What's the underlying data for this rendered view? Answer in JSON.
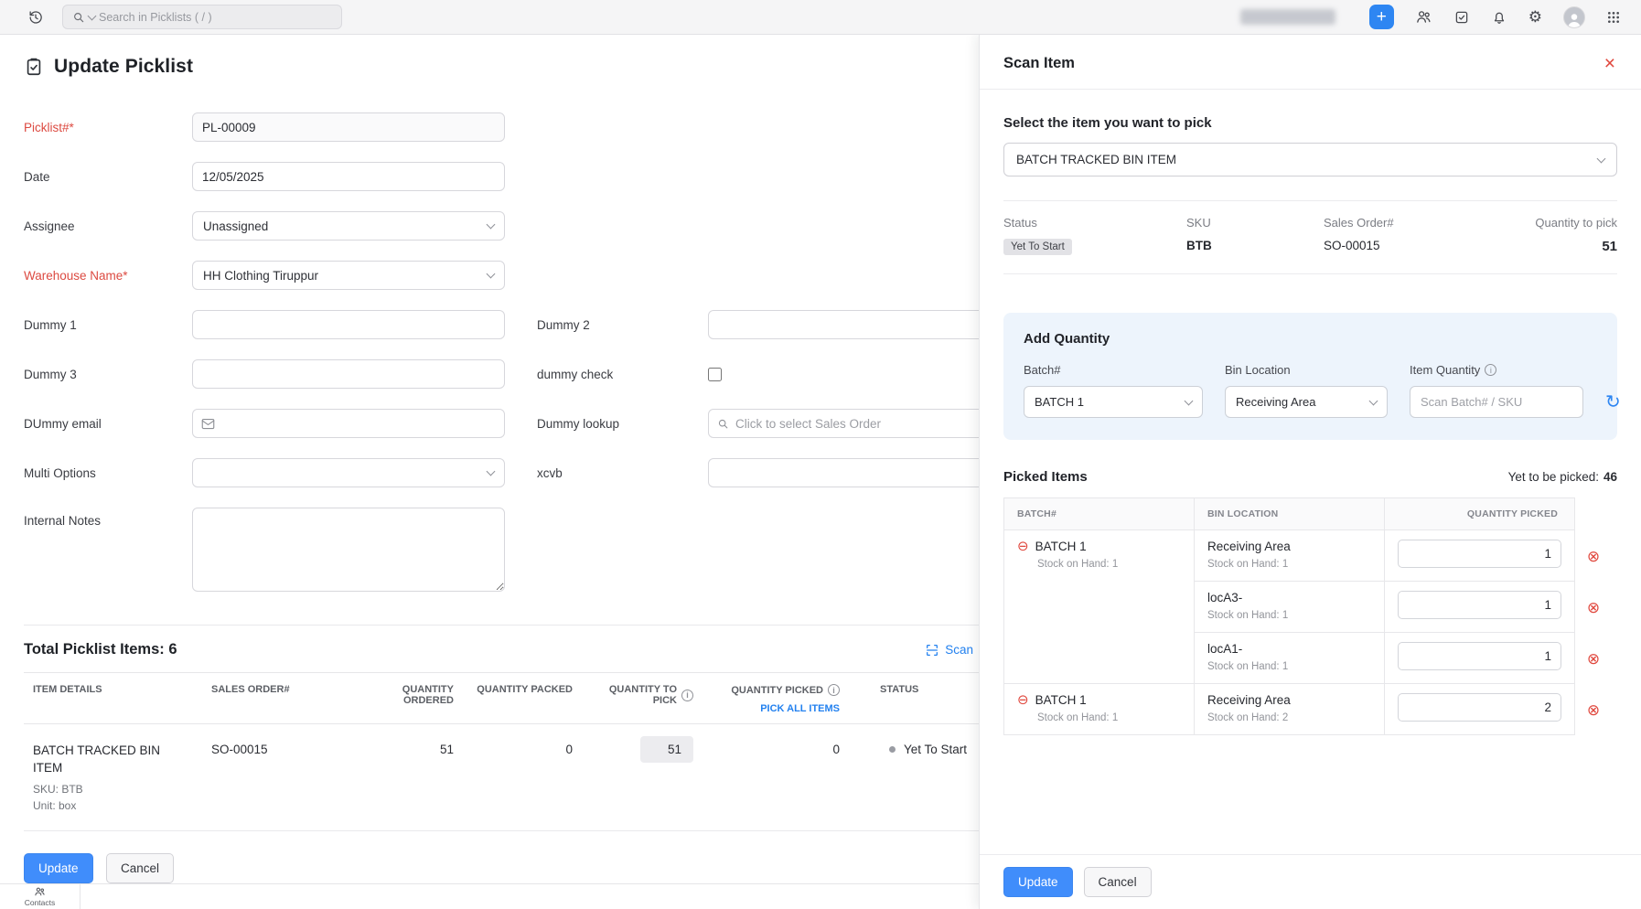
{
  "icons": {
    "gear": "⚙",
    "remove": "⊗",
    "minus": "⊖",
    "close": "×",
    "plus": "+",
    "info": "i",
    "refresh": "↻"
  },
  "colors": {
    "accent": "#408dfb",
    "danger": "#e0473d",
    "badge_bg": "#e2e2e6",
    "add_quantity_bg": "#edf4fc"
  },
  "topbar": {
    "search_placeholder": "Search in Picklists ( / )"
  },
  "main": {
    "title": "Update Picklist",
    "form": {
      "picklist": {
        "label": "Picklist#*",
        "value": "PL-00009"
      },
      "date": {
        "label": "Date",
        "value": "12/05/2025"
      },
      "assignee": {
        "label": "Assignee",
        "value": "Unassigned"
      },
      "warehouse": {
        "label": "Warehouse Name*",
        "value": "HH Clothing Tiruppur"
      },
      "dummy1": {
        "label": "Dummy 1",
        "value": ""
      },
      "dummy2": {
        "label": "Dummy 2",
        "value": ""
      },
      "dummy3": {
        "label": "Dummy 3",
        "value": ""
      },
      "dummy_check": {
        "label": "dummy check"
      },
      "dummy_email": {
        "label": "DUmmy email",
        "value": ""
      },
      "dummy_lookup": {
        "label": "Dummy lookup",
        "placeholder": "Click to select Sales Order"
      },
      "multi_options": {
        "label": "Multi Options",
        "value": ""
      },
      "xcvb": {
        "label": "xcvb",
        "value": ""
      },
      "internal_notes": {
        "label": "Internal Notes",
        "value": ""
      }
    },
    "items_section": {
      "title": "Total Picklist Items: 6",
      "scan_label": "Scan",
      "table": {
        "headers": [
          "ITEM DETAILS",
          "SALES ORDER#",
          "QUANTITY ORDERED",
          "QUANTITY PACKED",
          "QUANTITY TO PICK",
          "QUANTITY PICKED",
          "STATUS"
        ],
        "pick_all_label": "PICK ALL ITEMS",
        "rows": [
          {
            "item_name": "BATCH TRACKED BIN ITEM",
            "sku": "SKU: BTB",
            "unit": "Unit: box",
            "sales_order": "SO-00015",
            "quantity_ordered": "51",
            "quantity_packed": "0",
            "quantity_to_pick": "51",
            "quantity_picked": "0",
            "status": "Yet To Start"
          }
        ]
      }
    },
    "footer": {
      "update_label": "Update",
      "cancel_label": "Cancel"
    },
    "dock": {
      "contacts_label": "Contacts"
    }
  },
  "drawer": {
    "title": "Scan Item",
    "select_item": {
      "label": "Select the item you want to pick",
      "value": "BATCH TRACKED BIN ITEM"
    },
    "summary": {
      "status_label": "Status",
      "status_value": "Yet To Start",
      "sku_label": "SKU",
      "sku_value": "BTB",
      "sales_order_label": "Sales Order#",
      "sales_order_value": "SO-00015",
      "qty_label": "Quantity to pick",
      "qty_value": "51"
    },
    "add_quantity": {
      "title": "Add Quantity",
      "batch_label": "Batch#",
      "batch_value": "BATCH 1",
      "bin_label": "Bin Location",
      "bin_value": "Receiving Area",
      "item_qty_label": "Item Quantity",
      "scan_placeholder": "Scan Batch# / SKU"
    },
    "picked": {
      "title": "Picked Items",
      "yet_label": "Yet to be picked:",
      "yet_value": "46",
      "headers": [
        "BATCH#",
        "BIN LOCATION",
        "QUANTITY PICKED"
      ],
      "rows": [
        {
          "batch": "BATCH 1",
          "batch_stock": "Stock on Hand: 1",
          "bin": "Receiving Area",
          "bin_stock": "Stock on Hand: 1",
          "qty": "1"
        },
        {
          "batch": "",
          "batch_stock": "",
          "bin": "locA3-",
          "bin_stock": "Stock on Hand: 1",
          "qty": "1"
        },
        {
          "batch": "",
          "batch_stock": "",
          "bin": "locA1-",
          "bin_stock": "Stock on Hand: 1",
          "qty": "1"
        },
        {
          "batch": "BATCH 1",
          "batch_stock": "Stock on Hand: 1",
          "bin": "Receiving Area",
          "bin_stock": "Stock on Hand: 2",
          "qty": "2"
        }
      ]
    },
    "footer": {
      "update_label": "Update",
      "cancel_label": "Cancel"
    }
  }
}
